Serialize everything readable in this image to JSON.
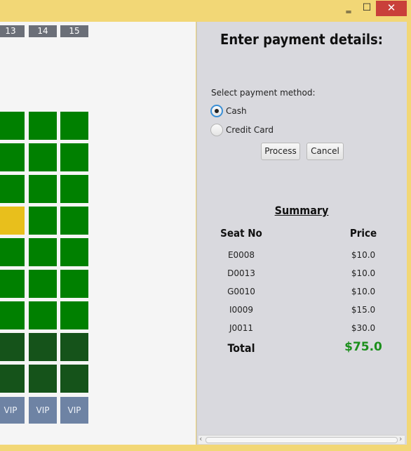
{
  "window": {
    "minimize_glyph": "‗",
    "maximize_glyph": "☐",
    "close_glyph": "✕"
  },
  "seat_map": {
    "column_headers": [
      "13",
      "14",
      "15"
    ],
    "rows": [
      [
        "available",
        "available",
        "available"
      ],
      [
        "available",
        "available",
        "available"
      ],
      [
        "available",
        "available",
        "available"
      ],
      [
        "selected",
        "available",
        "available"
      ],
      [
        "available",
        "available",
        "available"
      ],
      [
        "available",
        "available",
        "available"
      ],
      [
        "available",
        "available",
        "available"
      ],
      [
        "premium",
        "premium",
        "premium"
      ],
      [
        "premium",
        "premium",
        "premium"
      ]
    ],
    "vip_labels": [
      "VIP",
      "VIP",
      "VIP"
    ],
    "colors": {
      "available": "#008000",
      "selected": "#e8bf1c",
      "premium": "#15531a",
      "vip": "#6e83a4"
    }
  },
  "payment": {
    "title": "Enter payment details:",
    "method_label": "Select payment method:",
    "options": [
      {
        "label": "Cash",
        "checked": true
      },
      {
        "label": "Credit Card",
        "checked": false
      }
    ],
    "process_label": "Process",
    "cancel_label": "Cancel"
  },
  "summary": {
    "title": "Summary",
    "col_seat": "Seat No",
    "col_price": "Price",
    "items": [
      {
        "seat": "E0008",
        "price": "$10.0"
      },
      {
        "seat": "D0013",
        "price": "$10.0"
      },
      {
        "seat": "G0010",
        "price": "$10.0"
      },
      {
        "seat": "I0009",
        "price": "$15.0"
      },
      {
        "seat": "J0011",
        "price": "$30.0"
      }
    ],
    "total_label": "Total",
    "total_value": "$75.0",
    "total_color": "#1c8f1c"
  },
  "scrollbar": {
    "left_arrow": "‹",
    "right_arrow": "›"
  }
}
